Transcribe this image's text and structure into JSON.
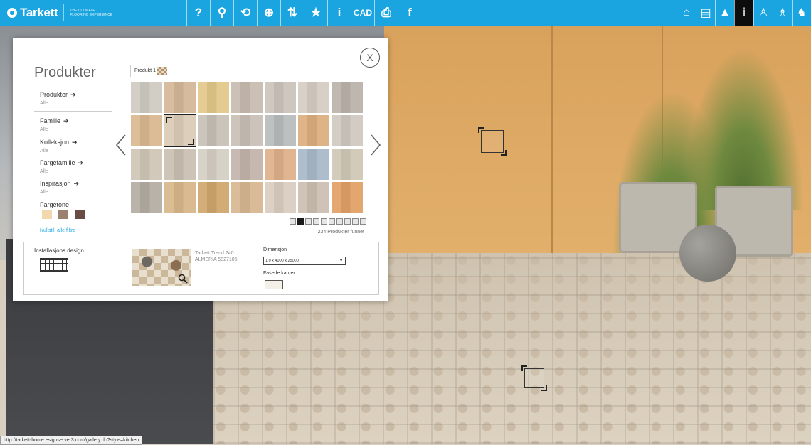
{
  "brand": {
    "name": "Tarkett",
    "tagline": "THE ULTIMATE FLOORING EXPERIENCE"
  },
  "toolbar": {
    "tools": [
      {
        "name": "help-icon",
        "glyph": "?"
      },
      {
        "name": "search-icon",
        "glyph": "⚲"
      },
      {
        "name": "rotate-icon",
        "glyph": "⟲"
      },
      {
        "name": "zoom-icon",
        "glyph": "⊕"
      },
      {
        "name": "compare-icon",
        "glyph": "⇅"
      },
      {
        "name": "star-icon",
        "glyph": "★"
      },
      {
        "name": "info-icon",
        "glyph": "i"
      },
      {
        "name": "cad-button",
        "glyph": "CAD"
      },
      {
        "name": "print-icon",
        "glyph": "⎙"
      },
      {
        "name": "facebook-icon",
        "glyph": "f"
      }
    ],
    "right_tools": [
      {
        "name": "room-view-icon",
        "glyph": "⌂"
      },
      {
        "name": "kitchen-icon",
        "glyph": "▤"
      },
      {
        "name": "car-icon",
        "glyph": "▲"
      },
      {
        "name": "info-panel-icon",
        "glyph": "i",
        "active": true
      },
      {
        "name": "chair-icon",
        "glyph": "♙"
      },
      {
        "name": "lamp-icon",
        "glyph": "♗"
      },
      {
        "name": "rocking-horse-icon",
        "glyph": "♞"
      }
    ]
  },
  "panel": {
    "title": "Produkter",
    "close_label": "X",
    "filters": [
      {
        "label": "Produkter",
        "value": "Alle"
      },
      {
        "label": "Familie",
        "value": "Alle"
      },
      {
        "label": "Kolleksjon",
        "value": "Alle"
      },
      {
        "label": "Fargefamilie",
        "value": "Alle"
      },
      {
        "label": "Inspirasjon",
        "value": "Alle"
      }
    ],
    "color_tone_label": "Fargetone",
    "color_tones": [
      "#f3d8ae",
      "#9c8070",
      "#6b4b46"
    ],
    "reset_label": "Nullstill alle filtre",
    "tab_label": "Produkt 1",
    "tiles": [
      "#cfcbc2",
      "#d5b798",
      "#e2c88a",
      "#c8bcb0",
      "#cbc4bc",
      "#d6cdc3",
      "#bab3ab",
      "#d9b890",
      "#dacbb6",
      "#c7c0b6",
      "#c9bfb6",
      "#b8bcbc",
      "#dcae7e",
      "#cfc9c0",
      "#cfc6b6",
      "#cabfb2",
      "#d5cfc4",
      "#c3b4ab",
      "#dfb08a",
      "#a8b9c8",
      "#cfc8b6",
      "#b4ada3",
      "#d8b78a",
      "#cfa76c",
      "#d8b791",
      "#d9cdbf",
      "#cbbfb1",
      "#e2a066"
    ],
    "selected_tile": 8,
    "pages": 10,
    "active_page": 1,
    "found_text": "234 Produkter funnet",
    "install_design_label": "Installasjons design",
    "product_name_line1": "Tarkett Trend 240",
    "product_name_line2": "ALMERIA 5827105",
    "dimension_label": "Dimensjon",
    "dimension_value": "1.0 x 4000 x 25000",
    "bevel_label": "Fasede kanter"
  },
  "status_url": "http://tarkett-home.esignserver3.com/gallery.do?style=kitchen"
}
